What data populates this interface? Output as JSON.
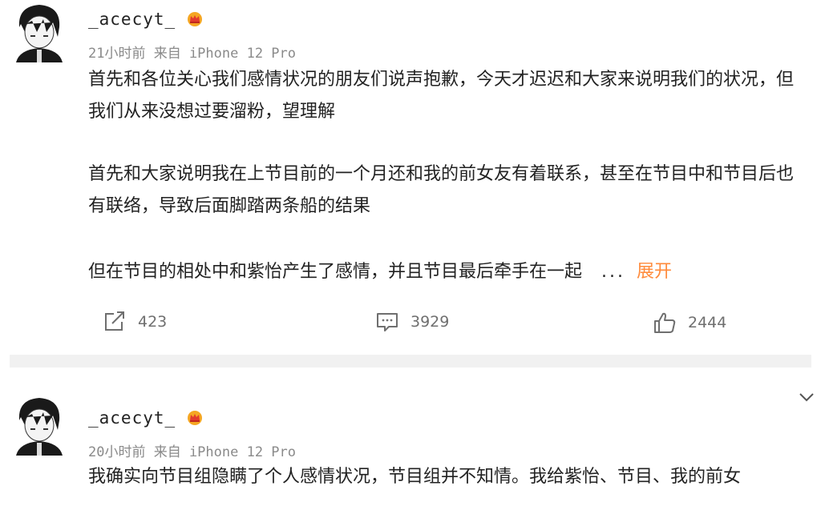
{
  "posts": [
    {
      "username": "_acecyt_",
      "meta": "21小时前 来自 iPhone 12 Pro",
      "paragraphs": [
        "首先和各位关心我们感情状况的朋友们说声抱歉，今天才迟迟和大家来说明我们的状况，但我们从来没想过要溜粉，望理解",
        "首先和大家说明我在上节目前的一个月还和我的前女友有着联系，甚至在节目中和节目后也有联络，导致后面脚踏两条船的结果",
        "但在节目的相处中和紫怡产生了感情，并且节目最后牵手在一起"
      ],
      "ellipsis": "...",
      "expand_label": "展开",
      "share_count": "423",
      "comment_count": "3929",
      "like_count": "2444"
    },
    {
      "username": "_acecyt_",
      "meta": "20小时前 来自 iPhone 12 Pro",
      "paragraphs": [
        "我确实向节目组隐瞒了个人感情状况，节目组并不知情。我给紫怡、节目、我的前女"
      ]
    }
  ],
  "icons": {
    "avatar": "avatar-anime-boy-icon",
    "vip": "vip-crown-badge-icon",
    "share": "share-icon",
    "comment": "comment-icon",
    "like": "thumbs-up-icon",
    "collapse": "chevron-down-icon"
  },
  "colors": {
    "expand": "#ff8a3a",
    "meta": "#8a8a8a",
    "divider": "#f1f1f1",
    "badge": "#f5a623"
  }
}
